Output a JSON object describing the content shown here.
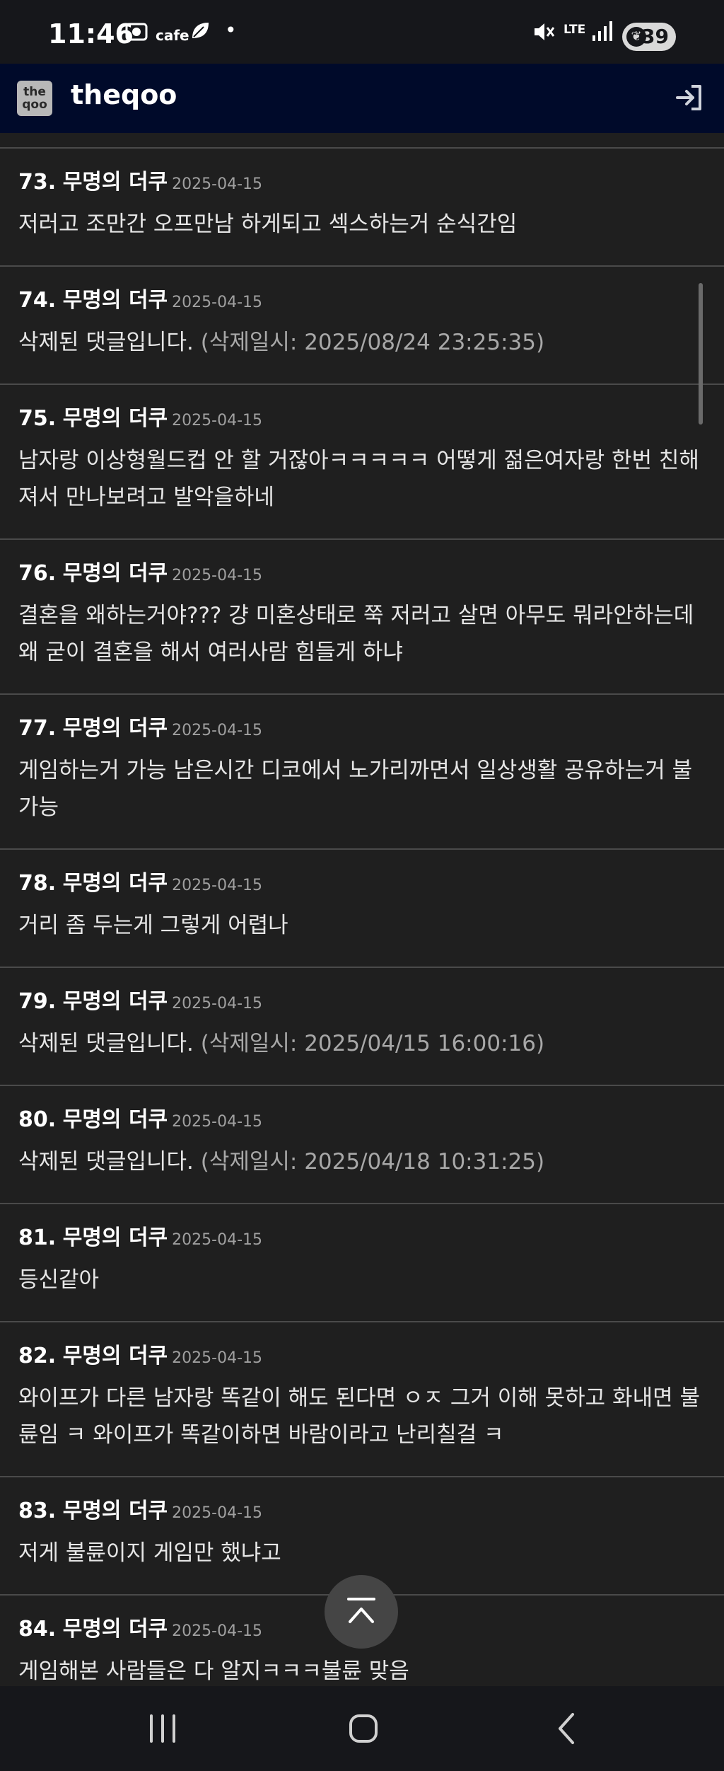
{
  "status_bar": {
    "time": "11:46",
    "cafe_label": "cafe",
    "dot": "•",
    "network": "LTE",
    "battery": "39"
  },
  "header": {
    "logo_text_top": "the",
    "logo_text_bottom": "qoo",
    "title": "theqoo"
  },
  "comments": [
    {
      "num": "73.",
      "author": "무명의 더쿠",
      "date": "2025-04-15",
      "text": "저러고 조만간 오프만남 하게되고 섹스하는거 순식간임",
      "deleted_time": ""
    },
    {
      "num": "74.",
      "author": "무명의 더쿠",
      "date": "2025-04-15",
      "text": "삭제된 댓글입니다.",
      "deleted_time": "(삭제일시: 2025/08/24 23:25:35)"
    },
    {
      "num": "75.",
      "author": "무명의 더쿠",
      "date": "2025-04-15",
      "text": "남자랑 이상형월드컵 안 할 거잖아ㅋㅋㅋㅋㅋ 어떻게 젊은여자랑 한번 친해져서 만나보려고 발악을하네",
      "deleted_time": ""
    },
    {
      "num": "76.",
      "author": "무명의 더쿠",
      "date": "2025-04-15",
      "text": "결혼을 왜하는거야??? 걍 미혼상태로 쭉 저러고 살면 아무도 뭐라안하는데 왜 굳이 결혼을 해서 여러사람 힘들게 하냐",
      "deleted_time": ""
    },
    {
      "num": "77.",
      "author": "무명의 더쿠",
      "date": "2025-04-15",
      "text": "게임하는거 가능 남은시간 디코에서 노가리까면서 일상생활 공유하는거 불가능",
      "deleted_time": ""
    },
    {
      "num": "78.",
      "author": "무명의 더쿠",
      "date": "2025-04-15",
      "text": "거리 좀 두는게 그렇게 어렵나",
      "deleted_time": ""
    },
    {
      "num": "79.",
      "author": "무명의 더쿠",
      "date": "2025-04-15",
      "text": "삭제된 댓글입니다.",
      "deleted_time": "(삭제일시: 2025/04/15 16:00:16)"
    },
    {
      "num": "80.",
      "author": "무명의 더쿠",
      "date": "2025-04-15",
      "text": "삭제된 댓글입니다.",
      "deleted_time": "(삭제일시: 2025/04/18 10:31:25)"
    },
    {
      "num": "81.",
      "author": "무명의 더쿠",
      "date": "2025-04-15",
      "text": "등신같아",
      "deleted_time": ""
    },
    {
      "num": "82.",
      "author": "무명의 더쿠",
      "date": "2025-04-15",
      "text": "와이프가 다른 남자랑 똑같이 해도 된다면 ㅇㅈ 그거 이해 못하고 화내면 불륜임 ㅋ 와이프가 똑같이하면 바람이라고 난리칠걸 ㅋ",
      "deleted_time": ""
    },
    {
      "num": "83.",
      "author": "무명의 더쿠",
      "date": "2025-04-15",
      "text": "저게 불륜이지 게임만 했냐고",
      "deleted_time": ""
    },
    {
      "num": "84.",
      "author": "무명의 더쿠",
      "date": "2025-04-15",
      "text": "게임해본 사람들은 다 알지ㅋㅋㅋ불륜 맞음",
      "deleted_time": ""
    }
  ],
  "icons": {
    "login": "login-icon",
    "scroll_top": "chevron-up-icon",
    "nav_recents": "recents-icon",
    "nav_home": "home-icon",
    "nav_back": "back-icon"
  },
  "colors": {
    "header_bg": "#000a2a",
    "content_bg": "#1f1f1f",
    "divider": "#4a4a4a"
  }
}
